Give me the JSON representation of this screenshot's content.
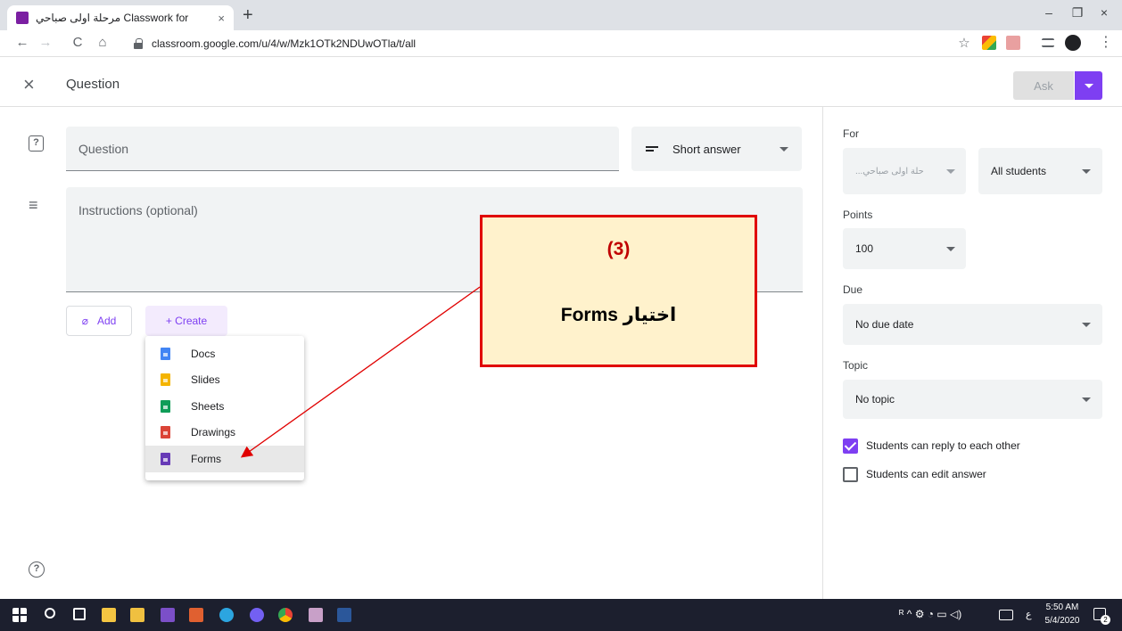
{
  "browser": {
    "tab_title": "مرحلة اولى صباحي Classwork for",
    "tab_close": "×",
    "new_tab": "+",
    "url": "classroom.google.com/u/4/w/Mzk1OTk2NDUwOTla/t/all",
    "win_minimize": "–",
    "win_restore": "❐",
    "win_close": "×",
    "back": "←",
    "forward": "→",
    "reload": "C",
    "home": "⌂",
    "star": "☆"
  },
  "header": {
    "close": "×",
    "title": "Question",
    "ask_label": "Ask"
  },
  "form": {
    "question_placeholder": "Question",
    "type_select": "Short answer",
    "instructions_placeholder": "Instructions (optional)",
    "add_label": "Add",
    "create_label": "+ Create",
    "menu": [
      {
        "label": "Docs",
        "color": "#4285f4"
      },
      {
        "label": "Slides",
        "color": "#f4b400"
      },
      {
        "label": "Sheets",
        "color": "#0f9d58"
      },
      {
        "label": "Drawings",
        "color": "#db4437"
      },
      {
        "label": "Forms",
        "color": "#673ab7"
      }
    ],
    "help": "?"
  },
  "sidebar": {
    "for_label": "For",
    "class_value": "...حلة اولى صباحي",
    "students_value": "All students",
    "points_label": "Points",
    "points_value": "100",
    "due_label": "Due",
    "due_value": "No due date",
    "topic_label": "Topic",
    "topic_value": "No topic",
    "reply_label": "Students can reply to each other",
    "reply_checked": true,
    "edit_label": "Students can edit answer",
    "edit_checked": false
  },
  "annotation": {
    "number": "(3)",
    "text": "اختيار Forms"
  },
  "taskbar": {
    "time": "5:50 AM",
    "date": "5/4/2020",
    "lang": "ع",
    "notif_count": "2"
  },
  "colors": {
    "accent": "#7e3ff2",
    "callout_border": "#e00000",
    "callout_fill": "#fff2cc"
  }
}
